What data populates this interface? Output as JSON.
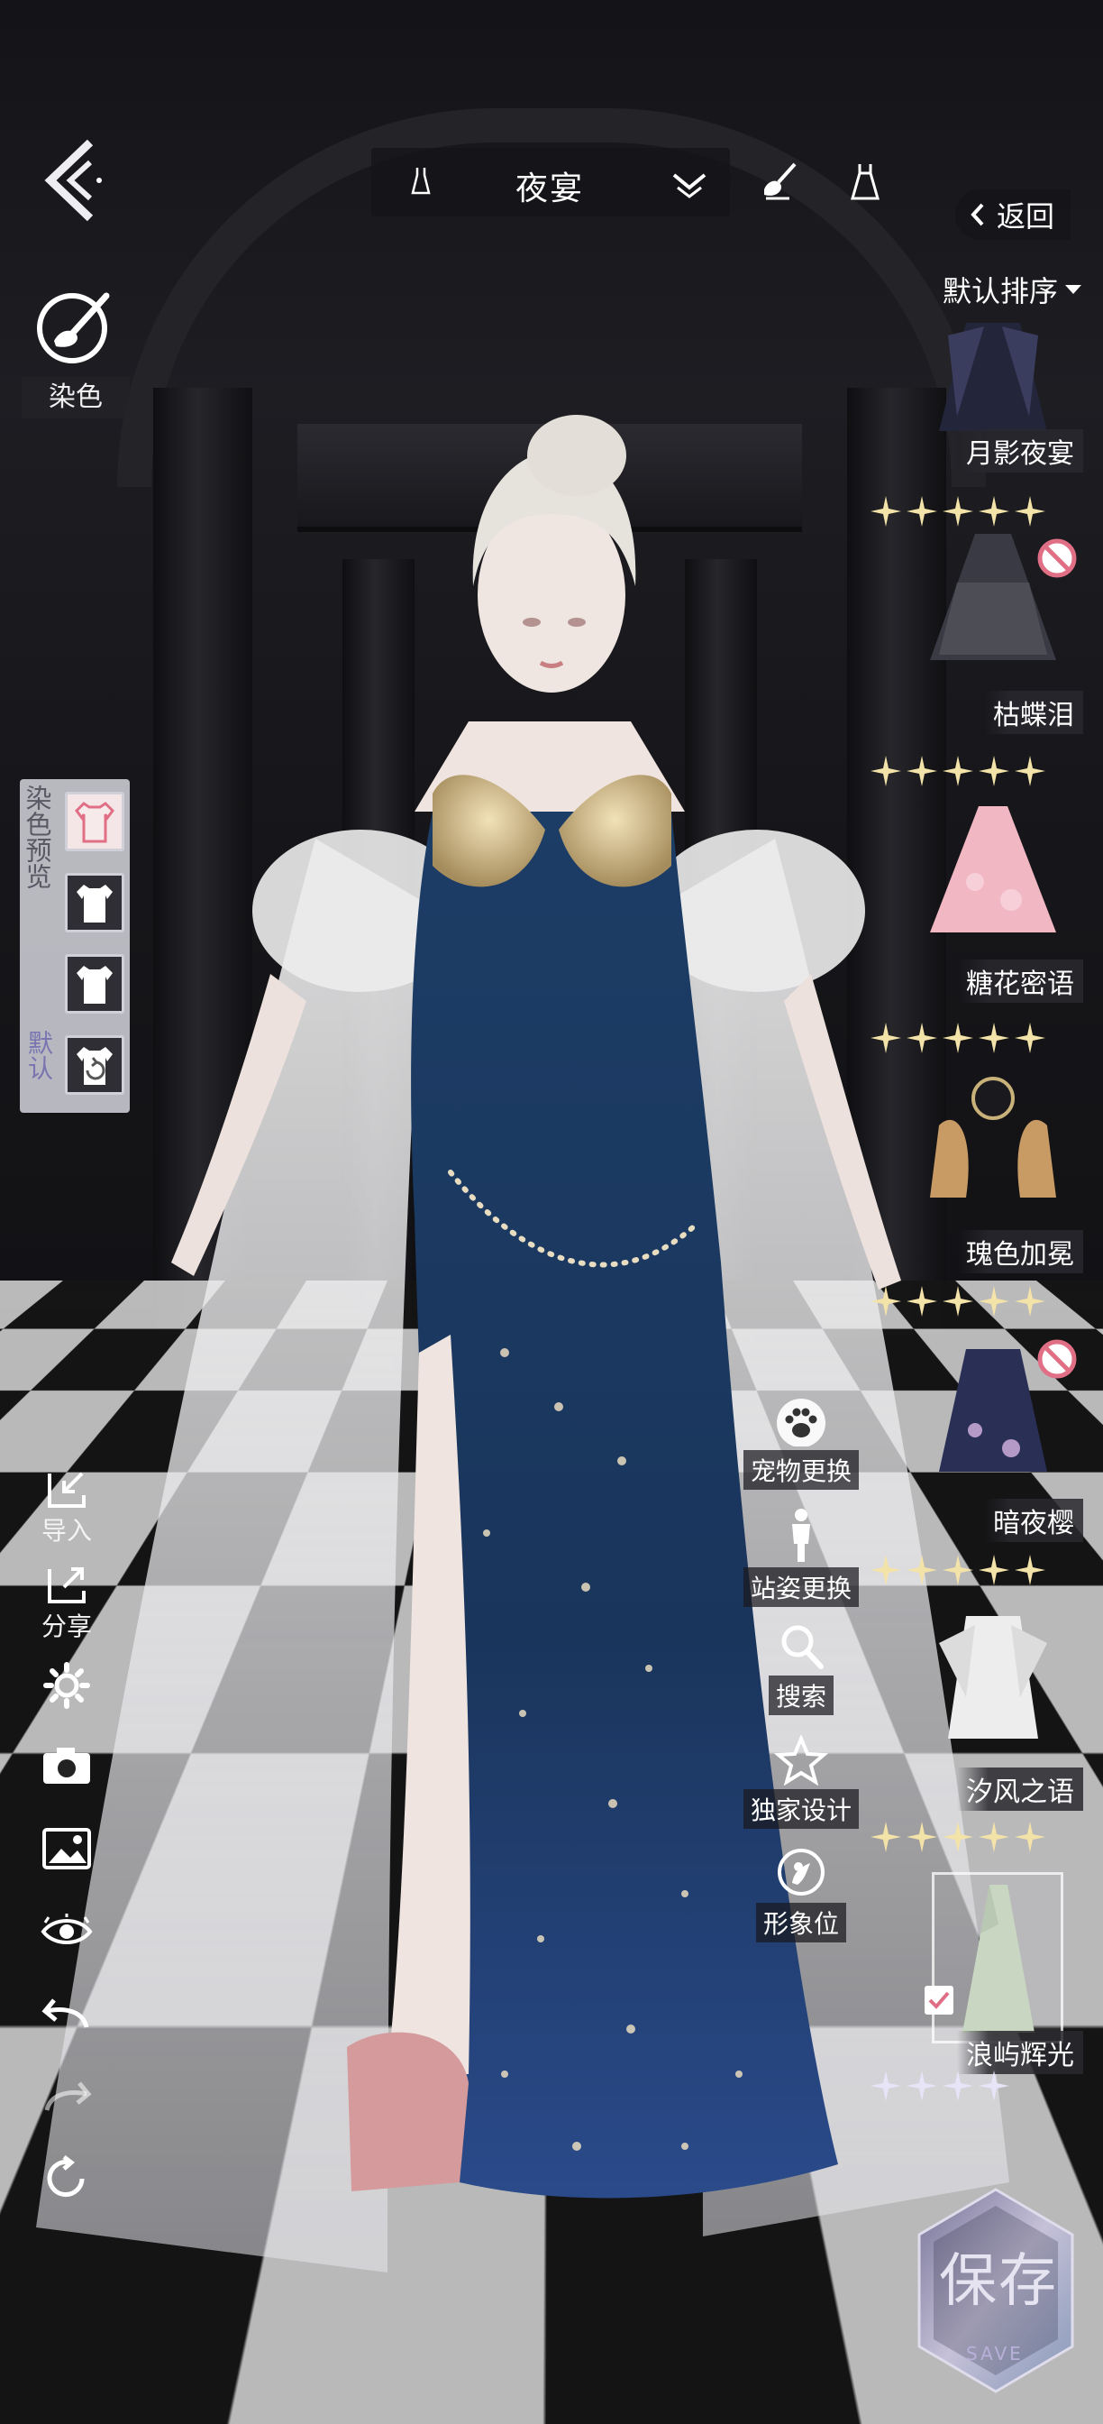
{
  "topbar": {
    "outfit_name": "夜宴",
    "return_label": "返回",
    "sort_label": "默认排序"
  },
  "dye": {
    "label": "染色"
  },
  "dye_preview": {
    "title": "染色预览",
    "default_label": "默认",
    "swatches": [
      "swatch-pink-top",
      "swatch-white-tee-1",
      "swatch-white-tee-2",
      "swatch-reset"
    ]
  },
  "left_toolbar": {
    "import_label": "导入",
    "share_label": "分享",
    "icons": [
      "import-icon",
      "share-icon",
      "settings-icon",
      "camera-icon",
      "image-icon",
      "eye-icon",
      "undo-icon",
      "redo-icon",
      "reset-icon"
    ]
  },
  "actions": {
    "pet_label": "宠物更换",
    "pose_label": "站姿更换",
    "search_label": "搜索",
    "exclusive_label": "独家设计",
    "image_label": "形象位"
  },
  "items": [
    {
      "name": "月影夜宴",
      "stars": 5
    },
    {
      "name": "枯蝶泪",
      "stars": 5
    },
    {
      "name": "糖花密语",
      "stars": 5
    },
    {
      "name": "瑰色加冕",
      "stars": 5
    },
    {
      "name": "暗夜樱",
      "stars": 5
    },
    {
      "name": "汐风之语",
      "stars": 5
    },
    {
      "name": "浪屿辉光",
      "stars": 4,
      "selected": true
    }
  ],
  "save": {
    "label": "保存",
    "sub": "SAVE"
  },
  "colors": {
    "accent_gold": "#f4e3a8",
    "dress_navy": "#1b3a63",
    "panel_dark": "#1e1e24"
  }
}
